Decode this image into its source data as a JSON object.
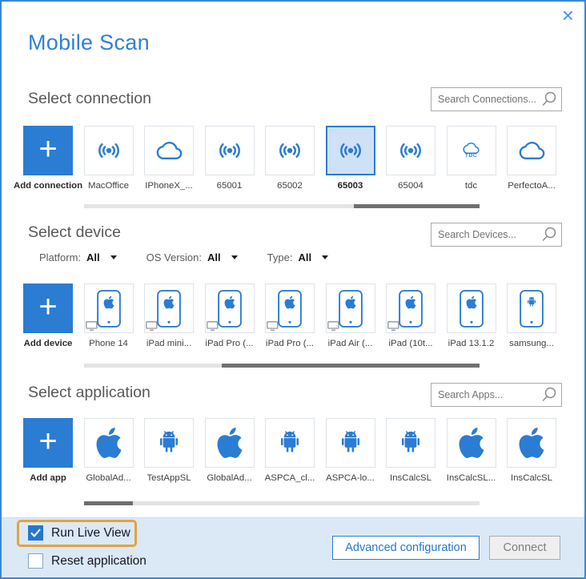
{
  "window": {
    "title": "Mobile Scan",
    "close_glyph": "×"
  },
  "colors": {
    "accent": "#2b7cd3",
    "selected_tile_bg": "#cfe1f6",
    "footer_bg": "#dbe9f7",
    "highlight_orange": "#e7a23b",
    "title_blue": "#2f80d6"
  },
  "connections": {
    "heading": "Select connection",
    "search_placeholder": "Search Connections...",
    "add_label": "Add connection",
    "items": [
      {
        "label": "MacOffice",
        "icon": "wireless",
        "selected": false
      },
      {
        "label": "IPhoneX_...",
        "icon": "cloud",
        "selected": false
      },
      {
        "label": "65001",
        "icon": "wireless",
        "selected": false
      },
      {
        "label": "65002",
        "icon": "wireless",
        "selected": false
      },
      {
        "label": "65003",
        "icon": "wireless",
        "selected": true
      },
      {
        "label": "65004",
        "icon": "wireless",
        "selected": false
      },
      {
        "label": "tdc",
        "icon": "cloud-tdc",
        "badge": "TDC",
        "selected": false
      },
      {
        "label": "PerfectoA...",
        "icon": "cloud",
        "selected": false
      }
    ]
  },
  "devices": {
    "heading": "Select device",
    "search_placeholder": "Search Devices...",
    "add_label": "Add device",
    "filters": [
      {
        "label": "Platform:",
        "value": "All"
      },
      {
        "label": "OS Version:",
        "value": "All"
      },
      {
        "label": "Type:",
        "value": "All"
      }
    ],
    "items": [
      {
        "label": "Phone 14",
        "os": "apple",
        "monitor": true
      },
      {
        "label": "iPad mini...",
        "os": "apple",
        "monitor": true
      },
      {
        "label": "iPad Pro (...",
        "os": "apple",
        "monitor": true
      },
      {
        "label": "iPad Pro (...",
        "os": "apple",
        "monitor": true
      },
      {
        "label": "iPad Air (...",
        "os": "apple",
        "monitor": true
      },
      {
        "label": "iPad (10t...",
        "os": "apple",
        "monitor": true
      },
      {
        "label": "iPad 13.1.2",
        "os": "apple",
        "monitor": false
      },
      {
        "label": "samsung...",
        "os": "android",
        "monitor": false
      }
    ]
  },
  "applications": {
    "heading": "Select application",
    "search_placeholder": "Search Apps...",
    "add_label": "Add app",
    "items": [
      {
        "label": "GlobalAd...",
        "os": "apple"
      },
      {
        "label": "TestAppSL",
        "os": "android"
      },
      {
        "label": "GlobalAd...",
        "os": "apple"
      },
      {
        "label": "ASPCA_cl...",
        "os": "android"
      },
      {
        "label": "ASPCA-lo...",
        "os": "android"
      },
      {
        "label": "InsCalcSL",
        "os": "android"
      },
      {
        "label": "InsCalcSL...",
        "os": "apple"
      },
      {
        "label": "InsCalcSL",
        "os": "apple"
      }
    ]
  },
  "footer": {
    "run_live_view": {
      "label": "Run Live View",
      "checked": true,
      "highlighted": true
    },
    "reset_application": {
      "label": "Reset application",
      "checked": false
    },
    "advanced_button": "Advanced configuration",
    "connect_button": "Connect"
  }
}
